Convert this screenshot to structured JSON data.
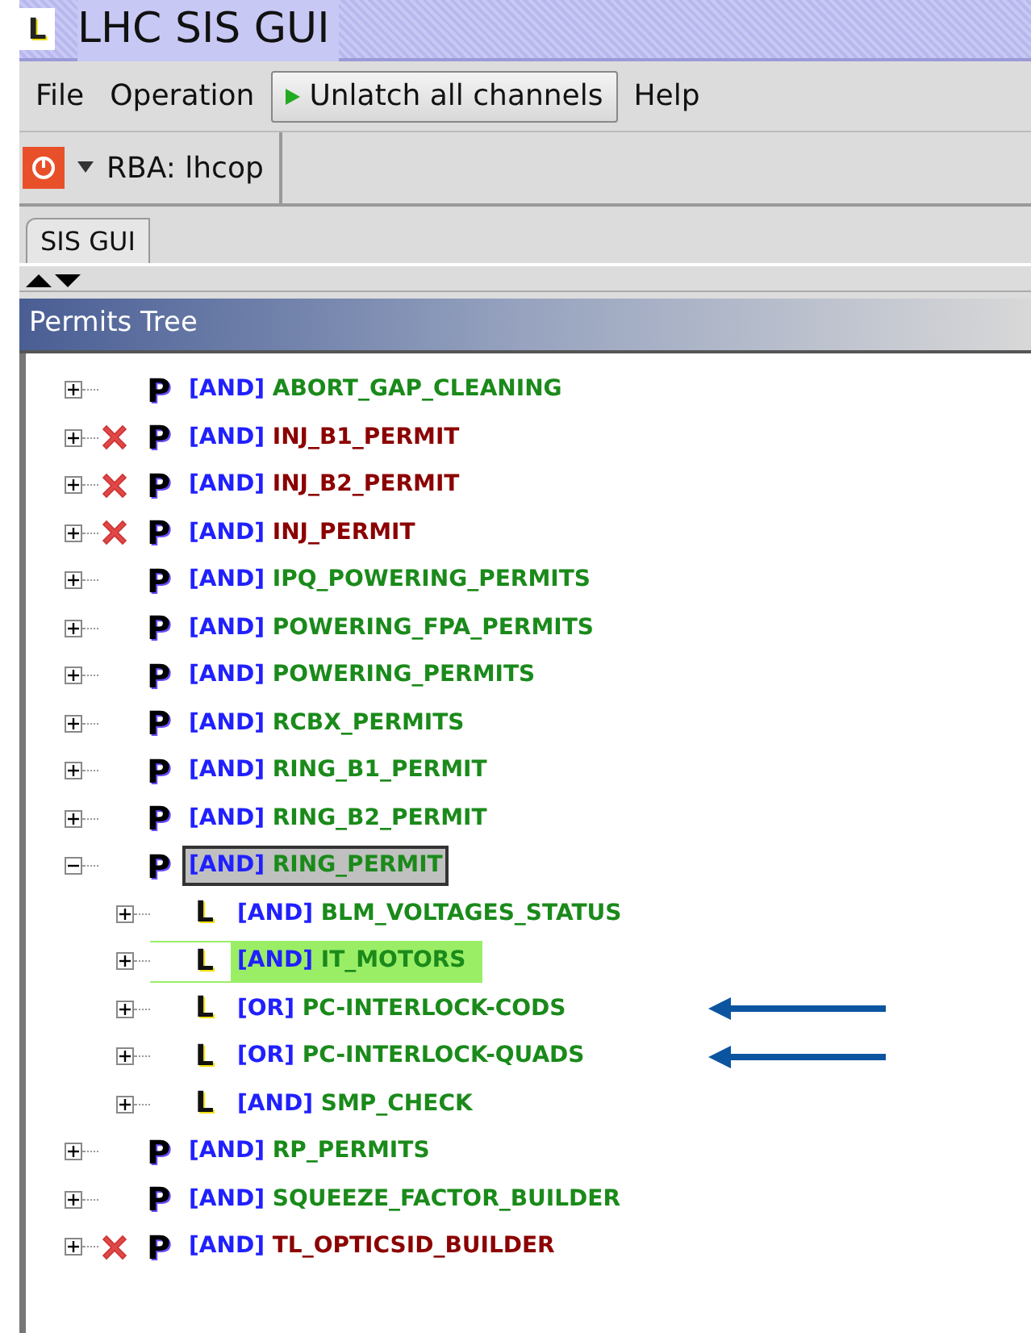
{
  "window": {
    "title": "LHC SIS GUI",
    "icon": "L"
  },
  "menu": [
    {
      "label": "File",
      "kind": "menu"
    },
    {
      "label": "Operation",
      "kind": "menu"
    },
    {
      "label": "Unlatch all channels",
      "kind": "button"
    },
    {
      "label": "Help",
      "kind": "menu"
    }
  ],
  "toolbar": {
    "rba": "RBA: lhcop"
  },
  "tabs": [
    {
      "label": "SIS GUI",
      "selected": true
    }
  ],
  "panel": {
    "title": "Permits Tree"
  },
  "tree": [
    {
      "icon": "P",
      "op": "[AND]",
      "name": "ABORT_GAP_CLEANING",
      "fault": false,
      "expanded": false,
      "selected": false
    },
    {
      "icon": "P",
      "op": "[AND]",
      "name": "INJ_B1_PERMIT",
      "fault": true,
      "expanded": false,
      "selected": false
    },
    {
      "icon": "P",
      "op": "[AND]",
      "name": "INJ_B2_PERMIT",
      "fault": true,
      "expanded": false,
      "selected": false
    },
    {
      "icon": "P",
      "op": "[AND]",
      "name": "INJ_PERMIT",
      "fault": true,
      "expanded": false,
      "selected": false
    },
    {
      "icon": "P",
      "op": "[AND]",
      "name": "IPQ_POWERING_PERMITS",
      "fault": false,
      "expanded": false,
      "selected": false
    },
    {
      "icon": "P",
      "op": "[AND]",
      "name": "POWERING_FPA_PERMITS",
      "fault": false,
      "expanded": false,
      "selected": false
    },
    {
      "icon": "P",
      "op": "[AND]",
      "name": "POWERING_PERMITS",
      "fault": false,
      "expanded": false,
      "selected": false
    },
    {
      "icon": "P",
      "op": "[AND]",
      "name": "RCBX_PERMITS",
      "fault": false,
      "expanded": false,
      "selected": false
    },
    {
      "icon": "P",
      "op": "[AND]",
      "name": "RING_B1_PERMIT",
      "fault": false,
      "expanded": false,
      "selected": false
    },
    {
      "icon": "P",
      "op": "[AND]",
      "name": "RING_B2_PERMIT",
      "fault": false,
      "expanded": false,
      "selected": false
    },
    {
      "icon": "P",
      "op": "[AND]",
      "name": "RING_PERMIT",
      "fault": false,
      "expanded": true,
      "selected": true,
      "children": [
        {
          "icon": "L",
          "op": "[AND]",
          "name": "BLM_VOLTAGES_STATUS",
          "fault": false,
          "expanded": false,
          "selected": false,
          "highlighted": false,
          "arrow": false
        },
        {
          "icon": "L",
          "op": "[AND]",
          "name": "IT_MOTORS",
          "fault": false,
          "expanded": false,
          "selected": false,
          "highlighted": true,
          "arrow": false
        },
        {
          "icon": "L",
          "op": "[OR]",
          "name": "PC-INTERLOCK-CODS",
          "fault": false,
          "expanded": false,
          "selected": false,
          "highlighted": false,
          "arrow": true
        },
        {
          "icon": "L",
          "op": "[OR]",
          "name": "PC-INTERLOCK-QUADS",
          "fault": false,
          "expanded": false,
          "selected": false,
          "highlighted": false,
          "arrow": true
        },
        {
          "icon": "L",
          "op": "[AND]",
          "name": "SMP_CHECK",
          "fault": false,
          "expanded": false,
          "selected": false,
          "highlighted": false,
          "arrow": false
        }
      ]
    },
    {
      "icon": "P",
      "op": "[AND]",
      "name": "RP_PERMITS",
      "fault": false,
      "expanded": false,
      "selected": false
    },
    {
      "icon": "P",
      "op": "[AND]",
      "name": "SQUEEZE_FACTOR_BUILDER",
      "fault": false,
      "expanded": false,
      "selected": false
    },
    {
      "icon": "P",
      "op": "[AND]",
      "name": "TL_OPTICSID_BUILDER",
      "fault": true,
      "expanded": false,
      "selected": false
    }
  ]
}
